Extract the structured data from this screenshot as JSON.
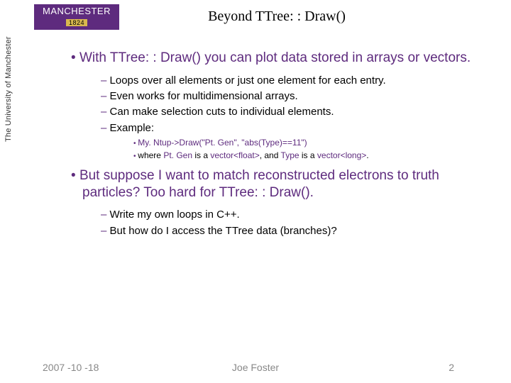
{
  "logo": {
    "name": "MANCHESTER",
    "year": "1824",
    "sub": "The University of Manchester"
  },
  "title": "Beyond TTree: : Draw()",
  "bullets": {
    "b1a": "With TTree: : Draw() you can plot data stored in arrays or vectors.",
    "s1": "Loops over all elements or just one element for each entry.",
    "s2": "Even works for multidimensional arrays.",
    "s3": "Can make selection cuts to individual elements.",
    "s4": "Example:",
    "e1": "My. Ntup->Draw(\"Pt. Gen\", \"abs(Type)==11\")",
    "e2a": "where ",
    "e2b": "Pt. Gen",
    "e2c": " is a ",
    "e2d": "vector<float>",
    "e2e": ", and ",
    "e2f": "Type",
    "e2g": " is a ",
    "e2h": "vector<long>",
    "e2i": ".",
    "b1b": "But suppose I want to match reconstructed electrons to truth particles?  Too hard for TTree: : Draw().",
    "s5": "Write my own loops in C++.",
    "s6": "But how do I access the TTree data (branches)?"
  },
  "footer": {
    "date": "2007 -10 -18",
    "author": "Joe Foster",
    "page": "2"
  }
}
